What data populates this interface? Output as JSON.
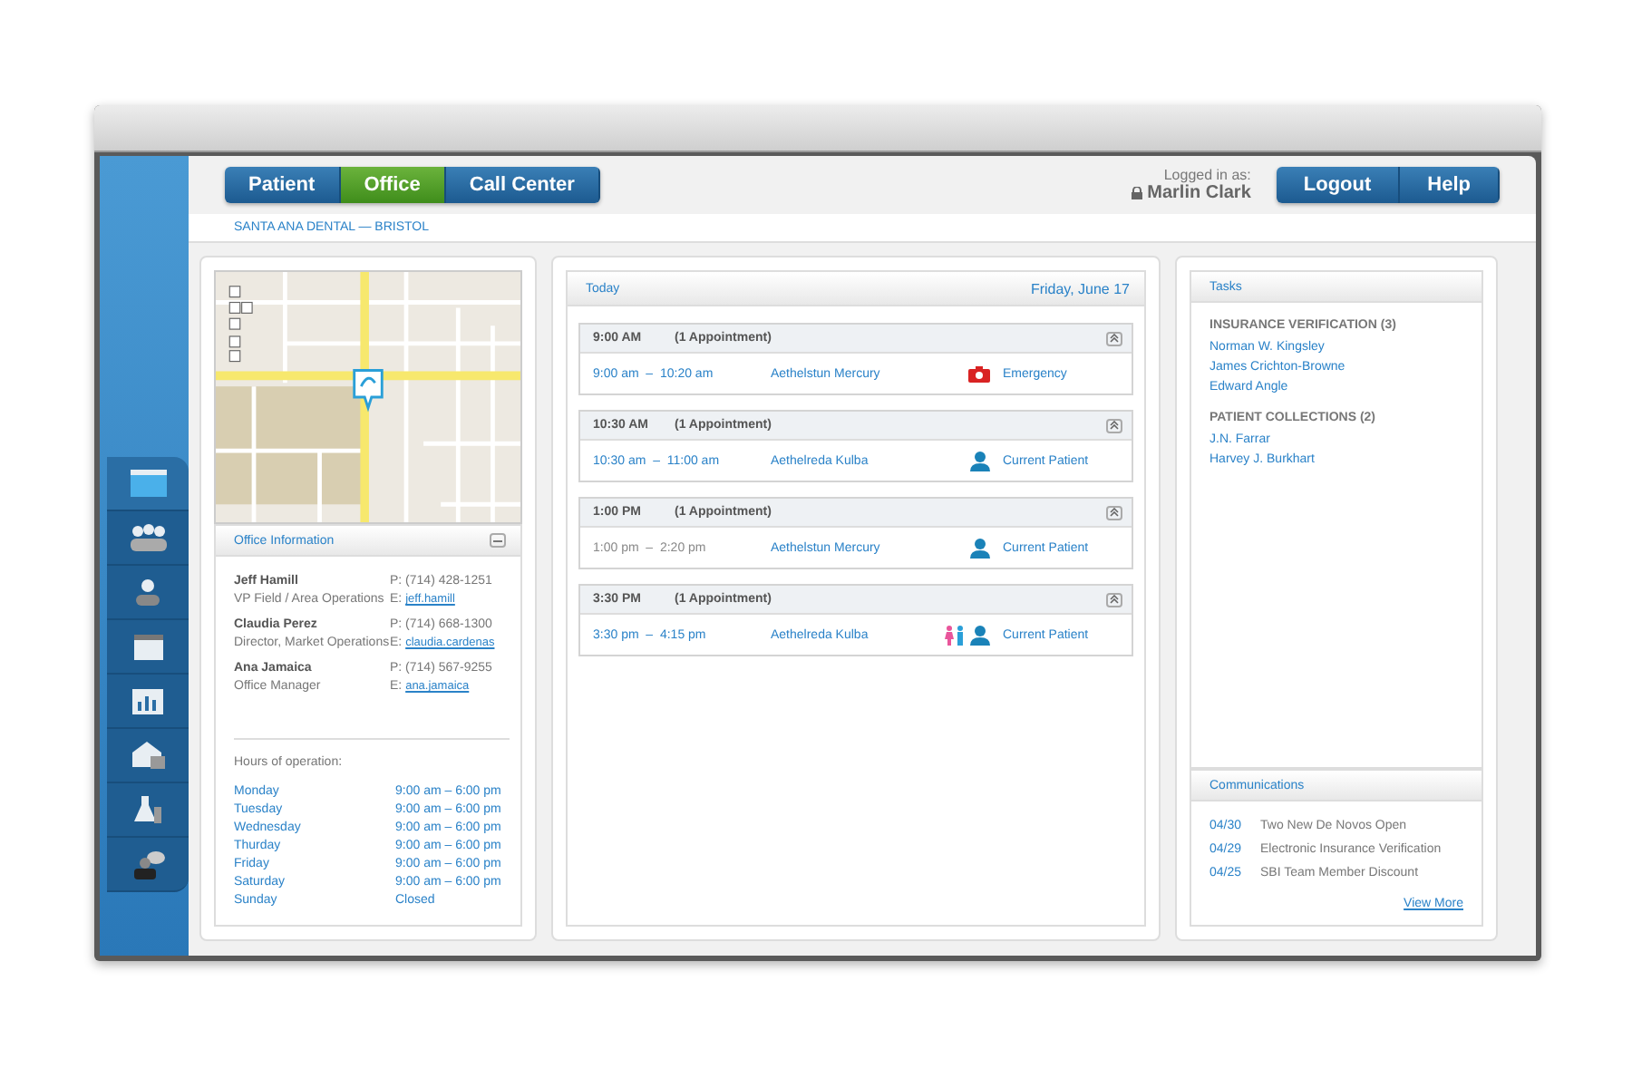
{
  "nav_tabs": [
    {
      "label": "Patient",
      "selected": false
    },
    {
      "label": "Office",
      "selected": true
    },
    {
      "label": "Call Center",
      "selected": false
    }
  ],
  "user": {
    "caption": "Logged in as:",
    "name": "Marlin Clark"
  },
  "header_buttons": [
    "Logout",
    "Help"
  ],
  "breadcrumb": "SANTA ANA DENTAL — BRISTOL",
  "sidebar": {
    "items": [
      {
        "kind": "window",
        "selected": true
      },
      {
        "kind": "group",
        "selected": false
      },
      {
        "kind": "person",
        "selected": false
      },
      {
        "kind": "calendar",
        "selected": false
      },
      {
        "kind": "chart",
        "selected": false
      },
      {
        "kind": "mail",
        "selected": false
      },
      {
        "kind": "lab",
        "selected": false
      },
      {
        "kind": "chat",
        "selected": false
      }
    ]
  },
  "office": {
    "title": "Office Information",
    "contacts": [
      {
        "name": "Jeff Hamill",
        "role": "VP Field / Area Operations",
        "phone": "P: (714) 428-1251",
        "email_label": "E:",
        "email": "jeff.hamill"
      },
      {
        "name": "Claudia Perez",
        "role": "Director, Market Operations",
        "phone": "P: (714) 668-1300",
        "email_label": "E:",
        "email": "claudia.cardenas"
      },
      {
        "name": "Ana Jamaica",
        "role": "Office Manager",
        "phone": "P: (714) 567-9255",
        "email_label": "E:",
        "email": "ana.jamaica"
      }
    ],
    "hours_title": "Hours of operation:",
    "hours": [
      {
        "day": "Monday",
        "time": "9:00 am – 6:00 pm"
      },
      {
        "day": "Tuesday",
        "time": "9:00 am – 6:00 pm"
      },
      {
        "day": "Wednesday",
        "time": "9:00 am – 6:00 pm"
      },
      {
        "day": "Thurday",
        "time": "9:00 am – 6:00 pm"
      },
      {
        "day": "Friday",
        "time": "9:00 am – 6:00 pm"
      },
      {
        "day": "Saturday",
        "time": "9:00 am – 6:00 pm"
      },
      {
        "day": "Sunday",
        "time": "Closed"
      }
    ]
  },
  "schedule": {
    "title": "Today",
    "date": "Friday, June 17",
    "slots": [
      {
        "time": "9:00 AM",
        "count": "(1 Appointment)",
        "appointment": {
          "range": "9:00 am  –  10:20 am",
          "past": false,
          "patient": "Aethelstun Mercury",
          "icons": [
            {
              "kind": "emergency"
            }
          ],
          "status": "Emergency"
        }
      },
      {
        "time": "10:30 AM",
        "count": "(1 Appointment)",
        "appointment": {
          "range": "10:30 am  –  11:00 am",
          "past": false,
          "patient": "Aethelreda Kulba",
          "icons": [
            {
              "kind": "patient"
            }
          ],
          "status": "Current Patient"
        }
      },
      {
        "time": "1:00 PM",
        "count": "(1 Appointment)",
        "appointment": {
          "range": "1:00 pm  –  2:20 pm",
          "past": true,
          "patient": "Aethelstun Mercury",
          "icons": [
            {
              "kind": "patient"
            }
          ],
          "status": "Current Patient"
        }
      },
      {
        "time": "3:30 PM",
        "count": "(1 Appointment)",
        "appointment": {
          "range": "3:30 pm  –  4:15 pm",
          "past": false,
          "patient": "Aethelreda Kulba",
          "icons": [
            {
              "kind": "family"
            },
            {
              "kind": "patient"
            }
          ],
          "status": "Current Patient"
        }
      }
    ]
  },
  "tasks": {
    "title": "Tasks",
    "groups": [
      {
        "heading": "INSURANCE VERIFICATION (3)",
        "items": [
          "Norman W. Kingsley",
          "James Crichton-Browne",
          "Edward Angle"
        ]
      },
      {
        "heading": "PATIENT COLLECTIONS (2)",
        "items": [
          "J.N. Farrar",
          "Harvey J. Burkhart"
        ]
      }
    ]
  },
  "communications": {
    "title": "Communications",
    "items": [
      {
        "date": "04/30",
        "text": "Two New De Novos Open"
      },
      {
        "date": "04/29",
        "text": "Electronic Insurance Verification"
      },
      {
        "date": "04/25",
        "text": "SBI Team Member Discount"
      }
    ],
    "more": "View More"
  }
}
